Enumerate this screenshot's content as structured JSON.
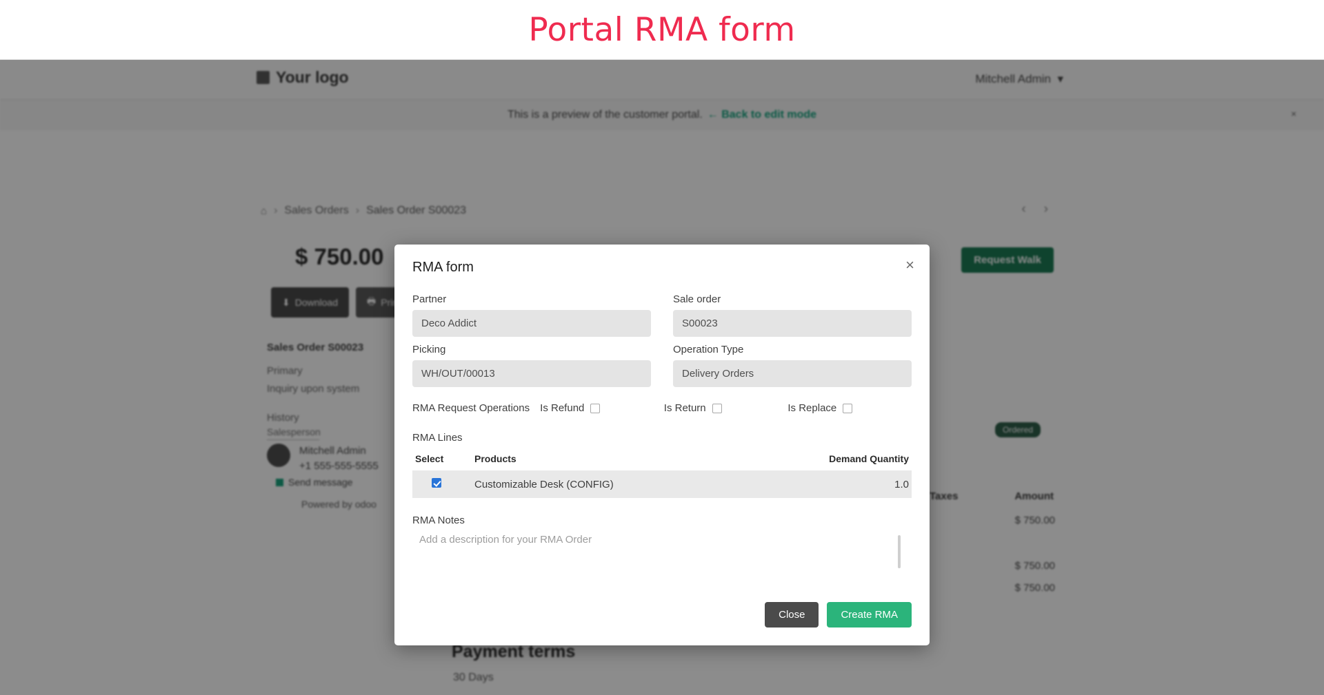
{
  "slide": {
    "title": "Portal RMA form",
    "title_color": "#ef2b4f"
  },
  "portal": {
    "brand": "Your logo",
    "user_menu": "Mitchell Admin",
    "preview_notice": "This is a preview of the customer portal.",
    "preview_link": "← Back to edit mode",
    "close_icon": "×",
    "breadcrumb": {
      "home": "⌂",
      "sep": "›",
      "parent": "Sales Orders",
      "current": "Sales Order S00023"
    },
    "pager": {
      "prev": "‹",
      "next": "›"
    },
    "amount": "$ 750.00",
    "request_quote_button": "Request Walk",
    "buttons": [
      {
        "label": "Download",
        "icon": "download-icon"
      },
      {
        "label": "Print",
        "icon": "print-icon"
      }
    ],
    "order_info": {
      "title": "Sales Order S00023",
      "lines": [
        "Primary",
        "Inquiry upon system",
        "History"
      ]
    },
    "salesperson_heading": "Salesperson",
    "person": {
      "name": "Mitchell Admin",
      "phone": "+1 555-555-5555",
      "email_label": "Send message"
    },
    "powered_by": "Powered by odoo",
    "status_badge": "Ordered",
    "table": {
      "headers": [
        "Taxes",
        "Amount"
      ],
      "amounts": [
        "$ 750.00",
        "$ 750.00",
        "$ 750.00"
      ]
    },
    "payment_terms_title": "Payment terms",
    "payment_terms_value": "30 Days"
  },
  "modal": {
    "title": "RMA form",
    "close_icon": "×",
    "fields": {
      "partner_label": "Partner",
      "partner_value": "Deco Addict",
      "sale_order_label": "Sale order",
      "sale_order_value": "S00023",
      "picking_label": "Picking",
      "picking_value": "WH/OUT/00013",
      "operation_type_label": "Operation Type",
      "operation_type_value": "Delivery Orders"
    },
    "operations": {
      "label": "RMA Request Operations",
      "items": [
        {
          "label": "Is Refund",
          "checked": false
        },
        {
          "label": "Is Return",
          "checked": false
        },
        {
          "label": "Is Replace",
          "checked": false
        }
      ]
    },
    "lines": {
      "label": "RMA Lines",
      "headers": {
        "select": "Select",
        "products": "Products",
        "demand": "Demand Quantity"
      },
      "rows": [
        {
          "selected": true,
          "product": "Customizable Desk (CONFIG)",
          "demand_quantity": "1.0"
        }
      ]
    },
    "notes": {
      "label": "RMA Notes",
      "placeholder": "Add a description for your RMA Order",
      "value": ""
    },
    "footer": {
      "close_label": "Close",
      "create_label": "Create RMA",
      "create_color": "#2bb47b"
    }
  }
}
